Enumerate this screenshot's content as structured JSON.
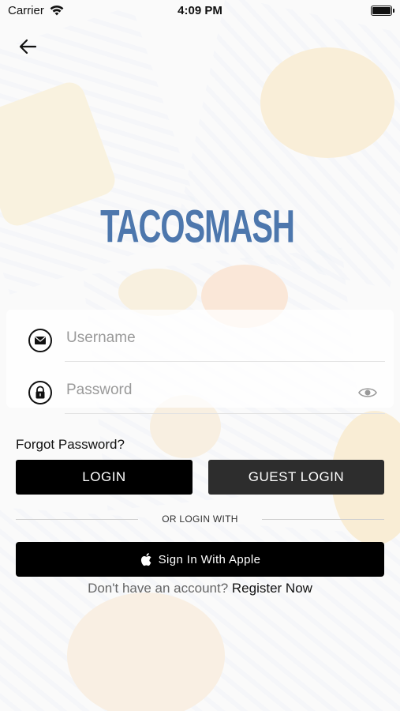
{
  "status_bar": {
    "carrier": "Carrier",
    "time": "4:09 PM"
  },
  "logo_text": "TACOSMASH",
  "form": {
    "username_placeholder": "Username",
    "password_placeholder": "Password"
  },
  "forgot_password": "Forgot Password?",
  "buttons": {
    "login": "LOGIN",
    "guest_login": "GUEST LOGIN"
  },
  "divider_text": "OR LOGIN WITH",
  "apple_button": "Sign In With Apple",
  "register": {
    "question": "Don't have an account?",
    "link": "Register Now"
  },
  "icons": [
    "back-arrow-icon",
    "wifi-icon",
    "battery-icon",
    "mail-icon",
    "lock-icon",
    "eye-icon",
    "apple-icon"
  ],
  "colors": {
    "logo": "#4d77ad",
    "primary_button": "#000000",
    "guest_button": "#2d2d2d"
  }
}
